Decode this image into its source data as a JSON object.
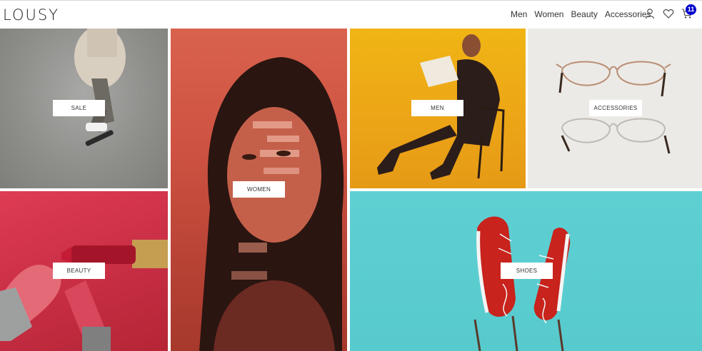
{
  "header": {
    "logo": "LOUSY",
    "nav": [
      "Men",
      "Women",
      "Beauty",
      "Accessories"
    ],
    "icons": [
      "user-icon",
      "heart-icon",
      "cart-icon"
    ],
    "cart_count": "11",
    "badge_color": "#0000cc"
  },
  "tiles": {
    "sale": "SALE",
    "women": "WOMEN",
    "men": "MEN",
    "accessories": "ACCESSORIES",
    "beauty": "BEAUTY",
    "shoes": "SHOES"
  }
}
